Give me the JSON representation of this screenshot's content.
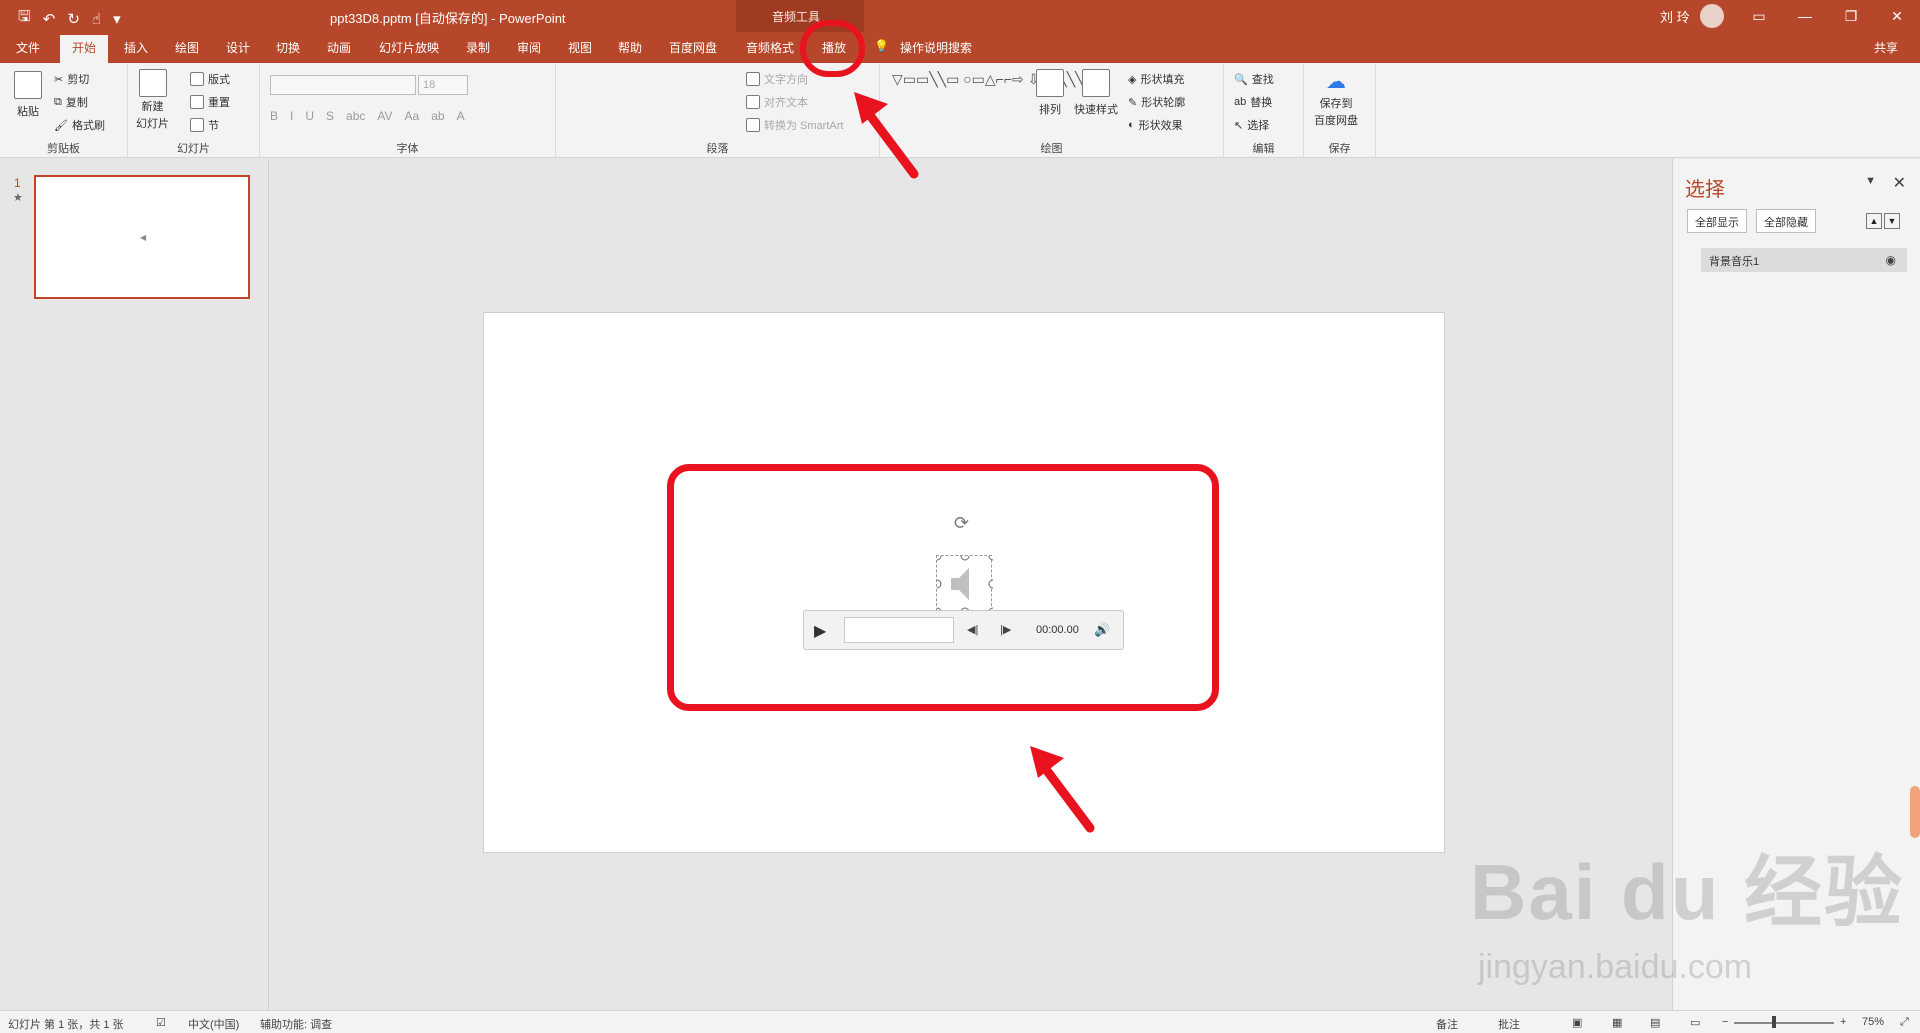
{
  "titlebar": {
    "qat_icons": [
      "save-icon",
      "undo-icon",
      "redo-icon",
      "touch-mode-icon",
      "customize-icon"
    ],
    "doc_title": "ppt33D8.pptm [自动保存的]  -  PowerPoint",
    "context_label": "音频工具",
    "user": "刘 玲",
    "window_controls": [
      "ribbon-display-icon",
      "minimize-icon",
      "restore-icon",
      "close-icon"
    ]
  },
  "tabs": {
    "file": "文件",
    "home": "开始",
    "insert": "插入",
    "draw": "绘图",
    "design": "设计",
    "transitions": "切换",
    "animations": "动画",
    "slideshow": "幻灯片放映",
    "record": "录制",
    "review": "审阅",
    "view": "视图",
    "help": "帮助",
    "baidu": "百度网盘",
    "audio_format": "音频格式",
    "playback": "播放",
    "tell_me": "操作说明搜索",
    "share": "共享"
  },
  "ribbon": {
    "clipboard": {
      "paste": "粘贴",
      "cut": "剪切",
      "copy": "复制",
      "format_painter": "格式刷",
      "label": "剪贴板"
    },
    "slides": {
      "new_slide_1": "新建",
      "new_slide_2": "幻灯片",
      "layout": "版式",
      "reset": "重置",
      "section": "节",
      "label": "幻灯片"
    },
    "font": {
      "size": "18",
      "label": "字体"
    },
    "paragraph": {
      "text_direction": "文字方向",
      "align_text": "对齐文本",
      "smartart": "转换为 SmartArt",
      "label": "段落"
    },
    "drawing": {
      "arrange": "排列",
      "quick_styles": "快速样式",
      "fill": "形状填充",
      "outline": "形状轮廓",
      "effects": "形状效果",
      "label": "绘图"
    },
    "editing": {
      "find": "查找",
      "replace": "替换",
      "select": "选择",
      "label": "编辑"
    },
    "save": {
      "btn_1": "保存到",
      "btn_2": "百度网盘",
      "label": "保存"
    }
  },
  "thumbs": {
    "num": "1",
    "star": "★"
  },
  "player": {
    "time": "00:00.00"
  },
  "selection_pane": {
    "title": "选择",
    "show_all": "全部显示",
    "hide_all": "全部隐藏",
    "item": "背景音乐1"
  },
  "status": {
    "slide_info": "幻灯片 第 1 张，共 1 张",
    "language": "中文(中国)",
    "accessibility": "辅助功能: 调查",
    "notes": "备注",
    "comments": "批注",
    "zoom": "75%"
  },
  "watermark": {
    "main": "Bai du 经验",
    "sub": "jingyan.baidu.com"
  },
  "colors": {
    "brand": "#b7472a",
    "annotation_red": "#e8131f"
  }
}
